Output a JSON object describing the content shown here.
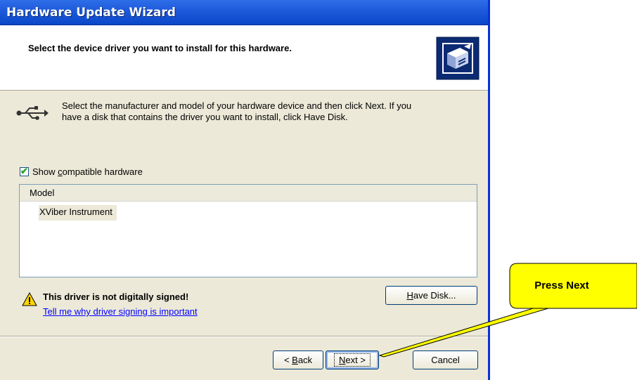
{
  "window": {
    "title": "Hardware Update Wizard"
  },
  "header": {
    "heading": "Select the device driver you want to install for this hardware."
  },
  "instructions": {
    "line1": "Select the manufacturer and model of your hardware device and then click Next. If you",
    "line2": "have a disk that contains the driver you want to install, click Have Disk."
  },
  "compatible": {
    "pre": "Show ",
    "accel": "c",
    "post": "ompatible hardware",
    "checked": true
  },
  "list": {
    "column_header": "Model",
    "items": [
      "XViber Instrument"
    ]
  },
  "warning": {
    "title": "This driver is not digitally signed!",
    "link": "Tell me why driver signing is important"
  },
  "buttons": {
    "have_disk": {
      "accel": "H",
      "rest": "ave Disk..."
    },
    "back": {
      "pre": "< ",
      "accel": "B",
      "rest": "ack"
    },
    "next": {
      "accel": "N",
      "rest": "ext >"
    },
    "cancel": "Cancel"
  },
  "callout": {
    "text": "Press Next",
    "fill": "#ffff00"
  },
  "colors": {
    "titlebar": "#0a47c9",
    "dialog_bg": "#ece9d8",
    "link": "#0000ff"
  }
}
